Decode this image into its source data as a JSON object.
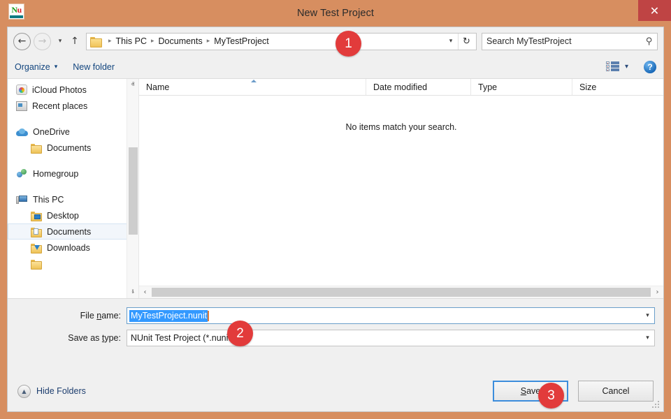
{
  "window": {
    "title": "New Test Project",
    "app_icon": "nunit-icon",
    "close_label": "✕",
    "titlebar_color": "#d78e60",
    "close_button_color": "#bf4444"
  },
  "nav": {
    "back_icon": "←",
    "forward_icon": "→",
    "history_icon": "▾",
    "up_icon": "↑",
    "breadcrumb": [
      "This PC",
      "Documents",
      "MyTestProject"
    ],
    "breadcrumb_separator": "▸",
    "address_dropdown_icon": "▾",
    "refresh_icon": "↻",
    "search_placeholder": "Search MyTestProject",
    "search_value": "",
    "search_icon": "⚲"
  },
  "toolbar": {
    "organize_label": "Organize",
    "organize_chevron": "▾",
    "new_folder_label": "New folder",
    "view_chevron": "▾",
    "help_label": "?"
  },
  "sidebar": {
    "items": [
      {
        "label": "iCloud Photos",
        "icon": "icloud-photos-icon",
        "indent": false,
        "selected": false
      },
      {
        "label": "Recent places",
        "icon": "recent-places-icon",
        "indent": false,
        "selected": false
      },
      {
        "label": "OneDrive",
        "icon": "onedrive-icon",
        "indent": false,
        "selected": false
      },
      {
        "label": "Documents",
        "icon": "folder-icon",
        "indent": true,
        "selected": false
      },
      {
        "label": "Homegroup",
        "icon": "homegroup-icon",
        "indent": false,
        "selected": false
      },
      {
        "label": "This PC",
        "icon": "computer-icon",
        "indent": false,
        "selected": false
      },
      {
        "label": "Desktop",
        "icon": "folder-desktop-icon",
        "indent": true,
        "selected": false
      },
      {
        "label": "Documents",
        "icon": "folder-documents-icon",
        "indent": true,
        "selected": true
      },
      {
        "label": "Downloads",
        "icon": "folder-downloads-icon",
        "indent": true,
        "selected": false
      }
    ],
    "scroll_up_icon": "ⱏ",
    "scroll_down_icon": "ⱛ"
  },
  "filelist": {
    "columns": [
      "Name",
      "Date modified",
      "Type",
      "Size"
    ],
    "sort_column": "Name",
    "sort_direction": "ascending",
    "rows": [],
    "empty_message": "No items match your search.",
    "hscroll_left_icon": "‹",
    "hscroll_right_icon": "›"
  },
  "form": {
    "filename_label_pre": "File ",
    "filename_label_key": "n",
    "filename_label_post": "ame:",
    "filename_value": "MyTestProject.nunit",
    "filename_selected": true,
    "savetype_label_pre": "Save as ",
    "savetype_label_key": "t",
    "savetype_label_post": "ype:",
    "savetype_value": "NUnit Test Project (*.nunit)",
    "combo_arrow": "▾"
  },
  "footer": {
    "hide_folders_label": "Hide Folders",
    "hide_folders_icon": "▲",
    "save_label_pre": "",
    "save_label_key": "S",
    "save_label_post": "ave",
    "cancel_label": "Cancel"
  },
  "badges": [
    {
      "number": "1",
      "target": "address-bar"
    },
    {
      "number": "2",
      "target": "file-name-input"
    },
    {
      "number": "3",
      "target": "save-button"
    }
  ]
}
